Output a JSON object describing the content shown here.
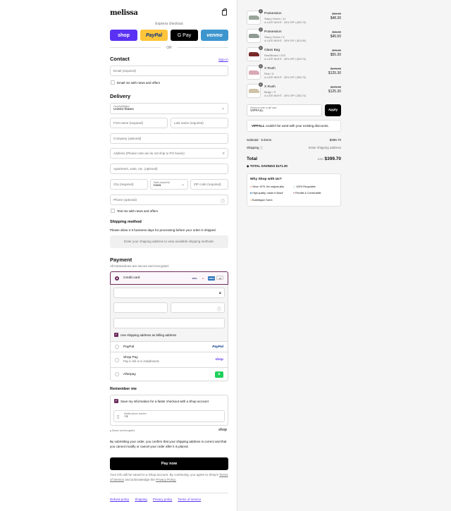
{
  "brand": {
    "logo": "melissa"
  },
  "express": {
    "label": "Express checkout",
    "buttons": [
      {
        "label": "shop",
        "bg": "#5a31f4",
        "fg": "#ffffff"
      },
      {
        "label": "PayPal",
        "bg": "#ffc439",
        "fg": "#003087"
      },
      {
        "label": "G Pay",
        "bg": "#000000",
        "fg": "#ffffff"
      },
      {
        "label": "venmo",
        "bg": "#3d95ce",
        "fg": "#ffffff"
      }
    ],
    "or": "OR"
  },
  "contact": {
    "title": "Contact",
    "sign_in": "Sign in",
    "email_placeholder": "Email (required)",
    "news": "Email me with news and offers"
  },
  "delivery": {
    "title": "Delivery",
    "country_label": "Country/Region",
    "country": "United States",
    "first_name": "First name (required)",
    "last_name": "Last name (required)",
    "company": "Company (optional)",
    "address": "Address (Please note we do not ship to PO boxes)",
    "apartment": "Apartment, suite, etc. (optional)",
    "city": "City (required)",
    "state_label": "State (required)",
    "state": "Iowa",
    "zip": "ZIP code (required)",
    "phone": "Phone (optional)",
    "text_me": "Text me with news and offers"
  },
  "shipping": {
    "title": "Shipping method",
    "note": "Please allow 2-3 business days for processing before your order is shipped.",
    "placeholder": "Enter your shipping address to view available shipping methods."
  },
  "payment": {
    "title": "Payment",
    "subtitle": "All transactions are secure and encrypted.",
    "credit_card": "Credit card",
    "cards": [
      "VISA",
      "MC",
      "AMEX",
      "+4"
    ],
    "billing": "Use shipping address as billing address",
    "paypal": "PayPal",
    "shop_pay": "Shop Pay",
    "shop_pay_sub": "Pay in full or in installments",
    "afterpay": "Afterpay",
    "paypal_logo": "PayPal",
    "shop_logo": "shop",
    "afterpay_logo": "$"
  },
  "remember": {
    "title": "Remember me",
    "save": "Save my information for a faster checkout with a Shop account",
    "phone_label": "Mobile phone number",
    "phone_prefix": "+1",
    "secure": "Secure and encrypted",
    "shop": "shop"
  },
  "consent": "By submitting your order, you confirm that your shipping address is correct and that you cannot modify or cancel your order after it is placed.",
  "pay_now": "Pay now",
  "legal": {
    "text": "Your info will be saved to a Shop account. By continuing, you agree to Shop's",
    "terms": "Terms of Service",
    "and": "and acknowledge the",
    "privacy": "Privacy Policy."
  },
  "footer": [
    "Refund policy",
    "Shipping",
    "Privacy policy",
    "Terms of service"
  ],
  "cart": {
    "items": [
      {
        "qty": "1",
        "name": "Possession",
        "variant": "Starry Green / 11",
        "discount": "LATE NIGHT - 30% OFF (-$20.70)",
        "old": "$69.00",
        "price": "$48.30",
        "color": "#9aa59a"
      },
      {
        "qty": "1",
        "name": "Possession",
        "variant": "Starry Green / 5",
        "discount": "LATE NIGHT - 30% OFF (-$19.50)",
        "old": "$65.00",
        "price": "$45.50",
        "color": "#8f9a92"
      },
      {
        "qty": "1",
        "name": "Glass Bag",
        "variant": "Red/Brown / O/S",
        "discount": "LATE NIGHT - 30% OFF (-$23.70)",
        "old": "$79.00",
        "price": "$55.30",
        "color": "#7a2a2a"
      },
      {
        "qty": "1",
        "name": "X Rush",
        "variant": "Pink / 5",
        "discount": "LATE NIGHT - 30% OFF (-$53.70)",
        "old": "$179.00",
        "price": "$125.30",
        "color": "#d9a9b6"
      },
      {
        "qty": "1",
        "name": "X Rush",
        "variant": "Beige / 9",
        "discount": "LATE NIGHT - 30% OFF (-$53.70)",
        "old": "$179.00",
        "price": "$125.30",
        "color": "#cfc3a9"
      }
    ],
    "discount_label": "Discount code or gift card",
    "discount_value": "VIPFALL",
    "apply": "Apply",
    "warning_code": "VIPFALL",
    "warning": "couldn't be used with your existing discounts.",
    "subtotal_label": "Subtotal · 5 items",
    "subtotal": "$399.70",
    "shipping_label": "Shipping",
    "shipping": "Enter shipping address",
    "total_label": "Total",
    "currency": "USD",
    "total": "$399.70",
    "savings_label": "TOTAL SAVINGS",
    "savings": "$171.30",
    "why": {
      "title": "Why Shop with Us?",
      "items": [
        "Since 1979, the original jelly",
        "100% Recyclable",
        "High quality, made in Brazil",
        "Flexible & Comfortable",
        "Bubblegum Scent"
      ]
    }
  }
}
